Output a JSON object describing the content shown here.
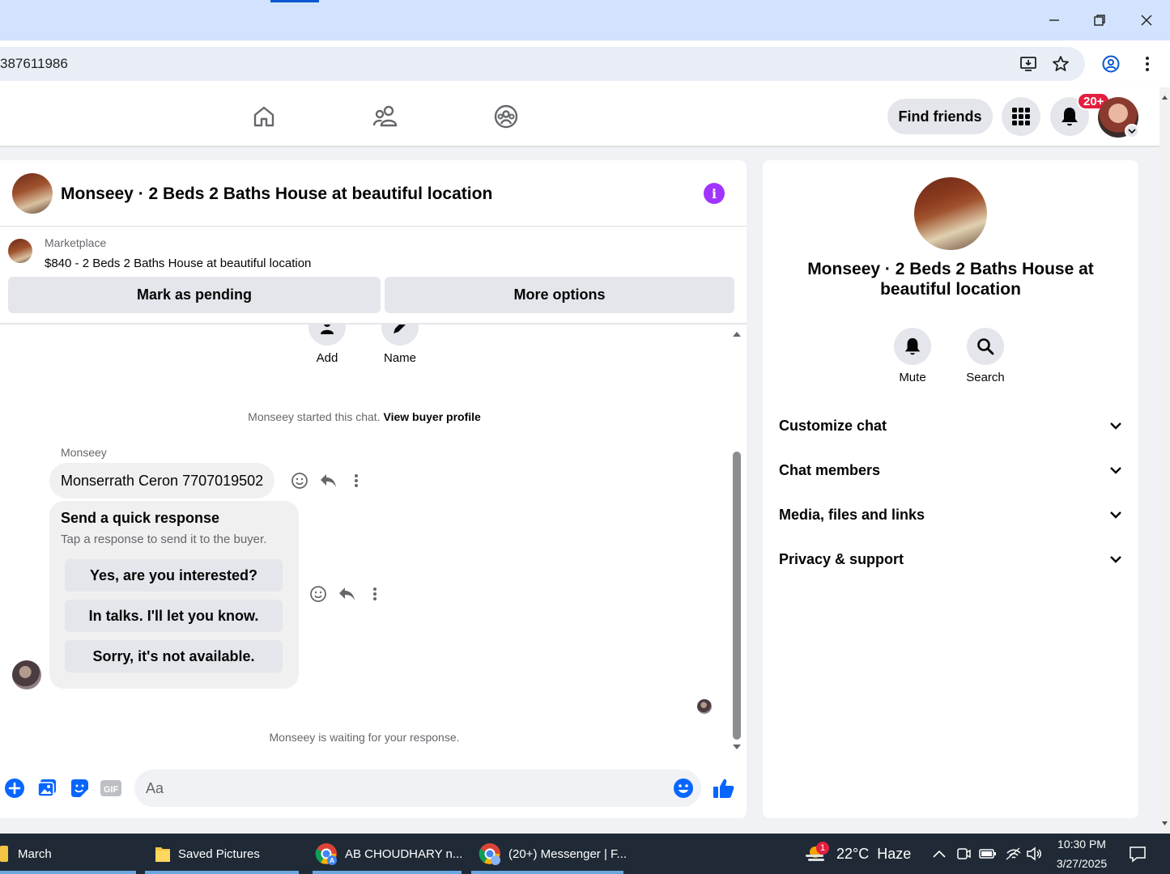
{
  "browser": {
    "url_fragment": "387611986"
  },
  "nav": {
    "find_friends": "Find friends",
    "notif_count": "20+"
  },
  "chat": {
    "title": "Monseey · 2 Beds 2 Baths House at beautiful location",
    "marketplace_label": "Marketplace",
    "listing": "$840 - 2 Beds 2 Baths House at beautiful location",
    "mark_pending": "Mark as pending",
    "more_options": "More options",
    "add_label": "Add",
    "name_label": "Name",
    "started_prefix": "Monseey started this chat.",
    "view_buyer_profile": "View buyer profile",
    "sender_name": "Monseey",
    "message1": "Monserrath Ceron 7707019502",
    "quick_title": "Send a quick response",
    "quick_sub": "Tap a response to send it to the buyer.",
    "quick_responses": [
      "Yes, are you interested?",
      "In talks. I'll let you know.",
      "Sorry, it's not available."
    ],
    "waiting": "Monseey is waiting for your response.",
    "composer_placeholder": "Aa"
  },
  "info_panel": {
    "title": "Monseey · 2 Beds 2 Baths House at beautiful location",
    "mute": "Mute",
    "search": "Search",
    "sections": [
      "Customize chat",
      "Chat members",
      "Media, files and links",
      "Privacy & support"
    ]
  },
  "taskbar": {
    "items": [
      "March",
      "Saved Pictures",
      "AB CHOUDHARY n...",
      "(20+) Messenger | F..."
    ],
    "weather": "22°C  Haze",
    "weather_badge": "1",
    "time": "10:30 PM",
    "date": "3/27/2025"
  },
  "colors": {
    "fb_blue": "#0866ff",
    "info_purple": "#a033ff",
    "badge_red": "#e41e3f"
  }
}
